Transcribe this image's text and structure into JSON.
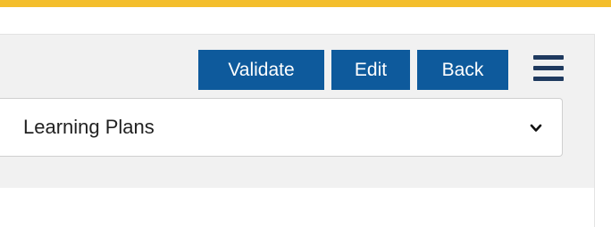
{
  "colors": {
    "accent_stripe": "#f3be2c",
    "button_primary": "#0e5a9c",
    "menu_icon": "#1f3a5f",
    "panel_background": "#f1f1f1"
  },
  "toolbar": {
    "validate_label": "Validate",
    "edit_label": "Edit",
    "back_label": "Back",
    "menu_icon": "hamburger-menu-icon"
  },
  "dropdown": {
    "selected": "Learning Plans",
    "icon": "chevron-down-icon"
  }
}
